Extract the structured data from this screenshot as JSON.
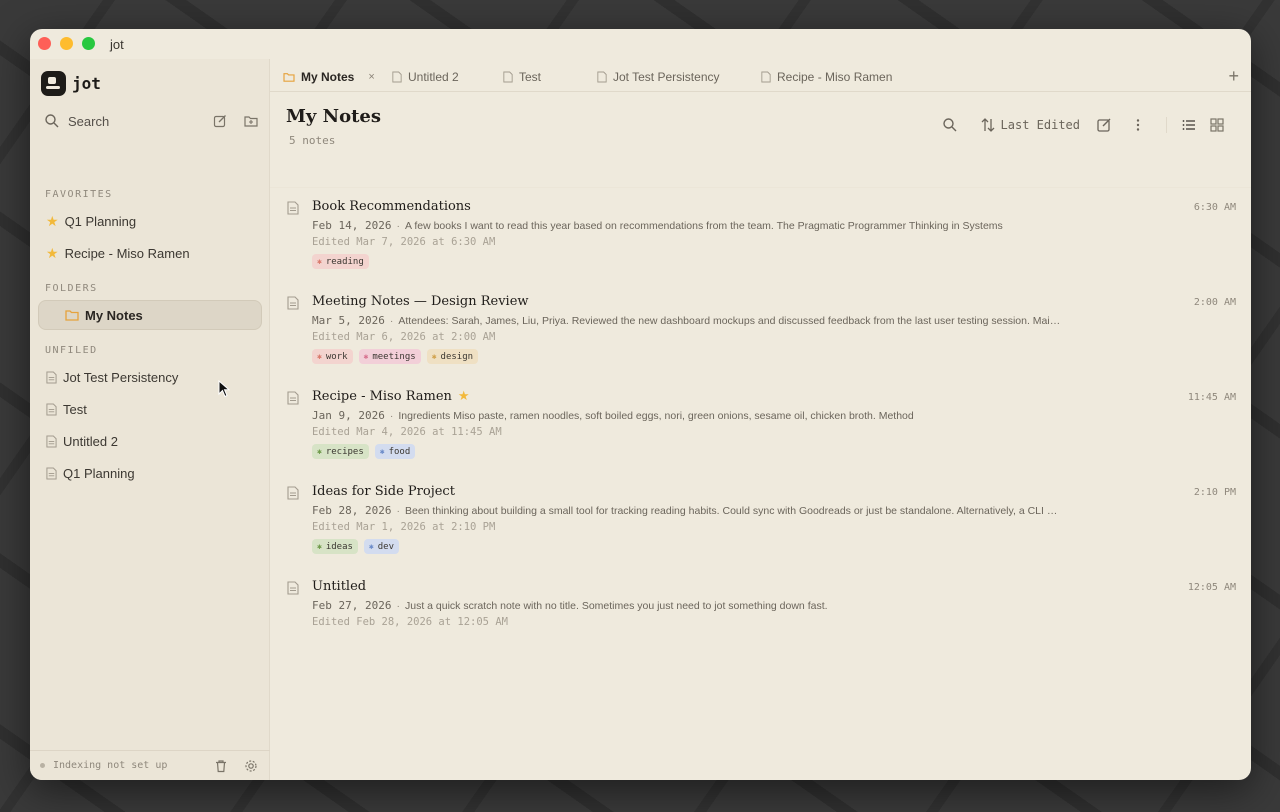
{
  "window": {
    "title": "jot"
  },
  "brand": {
    "name": "jot"
  },
  "sidebar": {
    "search_label": "Search",
    "favorites_label": "FAVORITES",
    "favorites": [
      {
        "label": "Q1 Planning"
      },
      {
        "label": "Recipe - Miso Ramen"
      }
    ],
    "folders_label": "FOLDERS",
    "folders": [
      {
        "label": "My Notes"
      }
    ],
    "unfiled_label": "UNFILED",
    "unfiled": [
      {
        "label": "Jot Test Persistency"
      },
      {
        "label": "Test"
      },
      {
        "label": "Untitled 2"
      },
      {
        "label": "Q1 Planning"
      }
    ],
    "status_text": "Indexing not set up"
  },
  "tabs": [
    {
      "label": "My Notes",
      "active": true,
      "close": "×"
    },
    {
      "label": "Untitled 2"
    },
    {
      "label": "Test"
    },
    {
      "label": "Jot Test Persistency"
    },
    {
      "label": "Recipe - Miso Ramen"
    }
  ],
  "tab_add": "+",
  "main": {
    "title": "My Notes",
    "count": "5 notes",
    "sort_label": "Last Edited"
  },
  "notes": [
    {
      "title": "Book Recommendations",
      "time": "6:30 AM",
      "date": "Feb 14, 2026",
      "sep": "·",
      "preview": "A few books I want to read this year based on recommendations from the team. The Pragmatic Programmer Thinking in Systems",
      "edited": "Edited Mar 7, 2026 at 6:30 AM",
      "tags": [
        {
          "label": "reading",
          "color": "#f3d4cf",
          "dot": "#d97a6c"
        }
      ]
    },
    {
      "title": "Meeting Notes — Design Review",
      "time": "2:00 AM",
      "date": "Mar 5, 2026",
      "sep": "·",
      "preview": "Attendees: Sarah, James, Liu, Priya. Reviewed the new dashboard mockups and discussed feedback from the last user testing session. Mai…",
      "edited": "Edited Mar 6, 2026 at 2:00 AM",
      "tags": [
        {
          "label": "work",
          "color": "#f3d4cf",
          "dot": "#d97a6c"
        },
        {
          "label": "meetings",
          "color": "#f2cfd8",
          "dot": "#d7708e"
        },
        {
          "label": "design",
          "color": "#efe0c3",
          "dot": "#d1a24e"
        }
      ]
    },
    {
      "title": "Recipe - Miso Ramen",
      "starred": true,
      "time": "11:45 AM",
      "date": "Jan 9, 2026",
      "sep": "·",
      "preview": "Ingredients Miso paste, ramen noodles, soft boiled eggs, nori, green onions, sesame oil, chicken broth. Method",
      "edited": "Edited Mar 4, 2026 at 11:45 AM",
      "tags": [
        {
          "label": "recipes",
          "color": "#d7e3c6",
          "dot": "#6f9a4a"
        },
        {
          "label": "food",
          "color": "#d3dcef",
          "dot": "#6b8bc9"
        }
      ]
    },
    {
      "title": "Ideas for Side Project",
      "time": "2:10 PM",
      "date": "Feb 28, 2026",
      "sep": "·",
      "preview": "Been thinking about building a small tool for tracking reading habits. Could sync with Goodreads or just be standalone. Alternatively, a CLI …",
      "edited": "Edited Mar 1, 2026 at 2:10 PM",
      "tags": [
        {
          "label": "ideas",
          "color": "#d7e3c6",
          "dot": "#6f9a4a"
        },
        {
          "label": "dev",
          "color": "#d3dcef",
          "dot": "#6b8bc9"
        }
      ]
    },
    {
      "title": "Untitled",
      "time": "12:05 AM",
      "date": "Feb 27, 2026",
      "sep": "·",
      "preview": "Just a quick scratch note with no title. Sometimes you just need to jot something down fast.",
      "edited": "Edited Feb 28, 2026 at 12:05 AM",
      "tags": []
    }
  ],
  "colors": {
    "accent_star": "#f2b93b",
    "folder": "#e6a23c",
    "background": "#efeadd"
  }
}
